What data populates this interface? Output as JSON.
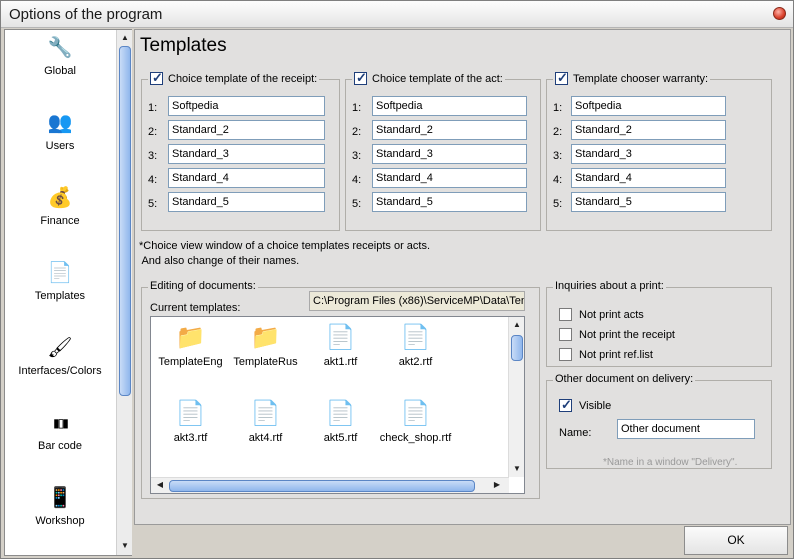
{
  "window": {
    "title": "Options of the program"
  },
  "sidebar": {
    "items": [
      {
        "label": "Global",
        "icon": "wrench-icon",
        "glyph": "🔧"
      },
      {
        "label": "Users",
        "icon": "users-icon",
        "glyph": "👥"
      },
      {
        "label": "Finance",
        "icon": "money-icon",
        "glyph": "💰"
      },
      {
        "label": "Templates",
        "icon": "note-icon",
        "glyph": "📄"
      },
      {
        "label": "Interfaces/Colors",
        "icon": "brush-icon",
        "glyph": "🖌"
      },
      {
        "label": "Bar code",
        "icon": "barcode-icon",
        "glyph": "▮▯▮"
      },
      {
        "label": "Workshop",
        "icon": "phone-icon",
        "glyph": "📱"
      }
    ]
  },
  "main": {
    "heading": "Templates",
    "receipt": {
      "label": "Choice template of the receipt:",
      "checked": true,
      "rows": [
        {
          "n": "1:",
          "value": "Softpedia"
        },
        {
          "n": "2:",
          "value": "Standard_2"
        },
        {
          "n": "3:",
          "value": "Standard_3"
        },
        {
          "n": "4:",
          "value": "Standard_4"
        },
        {
          "n": "5:",
          "value": "Standard_5"
        }
      ]
    },
    "act": {
      "label": "Choice template of the act:",
      "checked": true,
      "rows": [
        {
          "n": "1:",
          "value": "Softpedia"
        },
        {
          "n": "2:",
          "value": "Standard_2"
        },
        {
          "n": "3:",
          "value": "Standard_3"
        },
        {
          "n": "4:",
          "value": "Standard_4"
        },
        {
          "n": "5:",
          "value": "Standard_5"
        }
      ]
    },
    "warranty": {
      "label": "Template chooser warranty:",
      "checked": true,
      "rows": [
        {
          "n": "1:",
          "value": "Softpedia"
        },
        {
          "n": "2:",
          "value": "Standard_2"
        },
        {
          "n": "3:",
          "value": "Standard_3"
        },
        {
          "n": "4:",
          "value": "Standard_4"
        },
        {
          "n": "5:",
          "value": "Standard_5"
        }
      ]
    },
    "note_line1": "*Choice view  window of a choice templates receipts or acts.",
    "note_line2": " And also change of their names.",
    "editing": {
      "label": "Editing of documents:",
      "current_label": "Current templates:",
      "path": "C:\\Program Files (x86)\\ServiceMP\\Data\\Ten",
      "files": [
        {
          "name": "TemplateEng",
          "type": "folder"
        },
        {
          "name": "TemplateRus",
          "type": "folder"
        },
        {
          "name": "akt1.rtf",
          "type": "rtf"
        },
        {
          "name": "akt2.rtf",
          "type": "rtf"
        },
        {
          "name": "akt3.rtf",
          "type": "rtf"
        },
        {
          "name": "akt4.rtf",
          "type": "rtf"
        },
        {
          "name": "akt5.rtf",
          "type": "rtf"
        },
        {
          "name": "check_shop.rtf",
          "type": "rtf"
        }
      ]
    },
    "inquiries": {
      "label": "Inquiries about a print:",
      "options": [
        {
          "label": "Not print acts",
          "checked": false
        },
        {
          "label": "Not print the receipt",
          "checked": false
        },
        {
          "label": "Not print ref.list",
          "checked": false
        }
      ]
    },
    "other": {
      "label": "Other document on delivery:",
      "visible_label": "Visible",
      "visible_checked": true,
      "name_label": "Name:",
      "name_value": "Other document",
      "hint": "*Name in a window \"Delivery\"."
    }
  },
  "footer": {
    "ok_label": "OK"
  }
}
